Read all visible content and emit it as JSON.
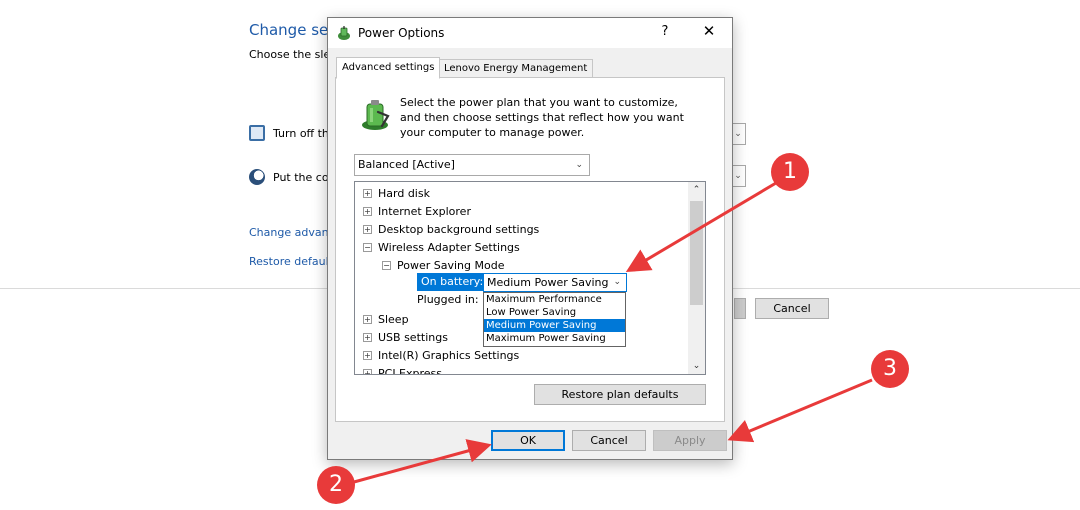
{
  "background": {
    "title": "Change set",
    "subtitle": "Choose the sle",
    "display_row": "Turn off th",
    "sleep_row": "Put the co",
    "link_advanced": "Change advanc",
    "link_restore": "Restore default",
    "cancel_label": "Cancel"
  },
  "dialog": {
    "title": "Power Options",
    "help_glyph": "?",
    "close_glyph": "✕",
    "tabs": [
      {
        "label": "Advanced settings",
        "active": true
      },
      {
        "label": "Lenovo Energy Management",
        "active": false
      }
    ],
    "description": "Select the power plan that you want to customize, and then choose settings that reflect how you want your computer to manage power.",
    "plan_select": "Balanced [Active]",
    "tree": [
      {
        "label": "Hard disk",
        "sign": "+"
      },
      {
        "label": "Internet Explorer",
        "sign": "+"
      },
      {
        "label": "Desktop background settings",
        "sign": "+"
      },
      {
        "label": "Wireless Adapter Settings",
        "sign": "−"
      },
      {
        "label": "Power Saving Mode",
        "sign": "−"
      },
      {
        "label": "Sleep",
        "sign": "+"
      },
      {
        "label": "USB settings",
        "sign": "+"
      },
      {
        "label": "Intel(R) Graphics Settings",
        "sign": "+"
      },
      {
        "label": "PCI Express",
        "sign": "+"
      }
    ],
    "on_battery_label": "On battery:",
    "on_battery_value": "Medium Power Saving",
    "plugged_in_label": "Plugged in:",
    "dropdown_options": [
      "Maximum Performance",
      "Low Power Saving",
      "Medium Power Saving",
      "Maximum Power Saving"
    ],
    "dropdown_selected_index": 2,
    "restore_label": "Restore plan defaults",
    "ok_label": "OK",
    "cancel_label": "Cancel",
    "apply_label": "Apply",
    "apply_enabled": false
  },
  "annotations": {
    "color": "#e83a3a",
    "badges": [
      "1",
      "2",
      "3"
    ]
  },
  "icons": {
    "app": "power-options-icon",
    "plan": "battery-plug-icon",
    "display": "monitor-clock-icon",
    "sleep": "moon-icon",
    "chevron": "chevron-down-icon"
  }
}
